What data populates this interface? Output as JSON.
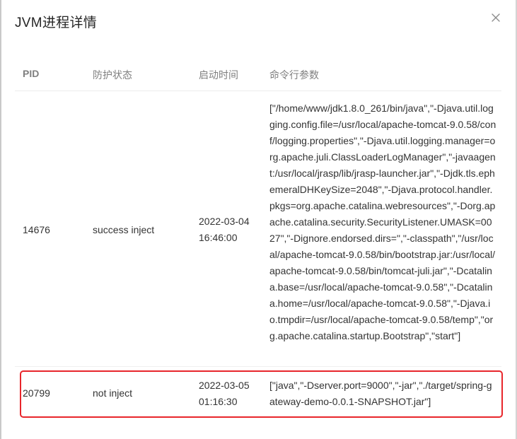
{
  "dialog": {
    "title": "JVM进程详情",
    "close_icon": "close-icon"
  },
  "table": {
    "columns": [
      "PID",
      "防护状态",
      "启动时间",
      "命令行参数"
    ],
    "rows": [
      {
        "pid": "14676",
        "status": "success inject",
        "start_date": "2022-03-04",
        "start_time": "16:46:00",
        "cmdline": "[\"/home/www/jdk1.8.0_261/bin/java\",\"-Djava.util.logging.config.file=/usr/local/apache-tomcat-9.0.58/conf/logging.properties\",\"-Djava.util.logging.manager=org.apache.juli.ClassLoaderLogManager\",\"-javaagent:/usr/local/jrasp/lib/jrasp-launcher.jar\",\"-Djdk.tls.ephemeralDHKeySize=2048\",\"-Djava.protocol.handler.pkgs=org.apache.catalina.webresources\",\"-Dorg.apache.catalina.security.SecurityListener.UMASK=0027\",\"-Dignore.endorsed.dirs=\",\"-classpath\",\"/usr/local/apache-tomcat-9.0.58/bin/bootstrap.jar:/usr/local/apache-tomcat-9.0.58/bin/tomcat-juli.jar\",\"-Dcatalina.base=/usr/local/apache-tomcat-9.0.58\",\"-Dcatalina.home=/usr/local/apache-tomcat-9.0.58\",\"-Djava.io.tmpdir=/usr/local/apache-tomcat-9.0.58/temp\",\"org.apache.catalina.startup.Bootstrap\",\"start\"]"
      },
      {
        "pid": "20799",
        "status": "not inject",
        "start_date": "2022-03-05",
        "start_time": "01:16:30",
        "cmdline": "[\"java\",\"-Dserver.port=9000\",\"-jar\",\"./target/spring-gateway-demo-0.0.1-SNAPSHOT.jar\"]"
      }
    ]
  },
  "colors": {
    "highlight_border": "#e8262b",
    "header_text": "#7f7f7f",
    "body_text": "#333333"
  }
}
